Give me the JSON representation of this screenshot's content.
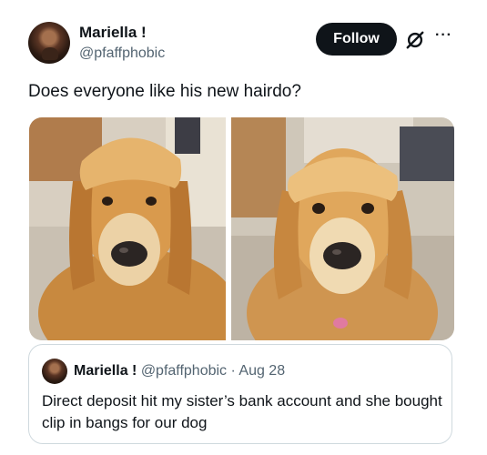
{
  "author": {
    "name": "Mariella !",
    "handle": "@pfaffphobic"
  },
  "header": {
    "follow_label": "Follow",
    "grok_icon": "grok-slash-icon",
    "more_icon": "more-dots-icon",
    "more_text": "···"
  },
  "tweet": {
    "text": "Does everyone like his new hairdo?"
  },
  "media": [
    {
      "description": "golden retriever wearing clip-in bangs, front view"
    },
    {
      "description": "golden retriever wearing clip-in bangs, looking at camera"
    }
  ],
  "quote": {
    "name": "Mariella !",
    "handle": "@pfaffphobic",
    "separator": "·",
    "date": "Aug 28",
    "text": "Direct deposit hit my sister’s bank account and she bought clip in bangs for our dog"
  }
}
